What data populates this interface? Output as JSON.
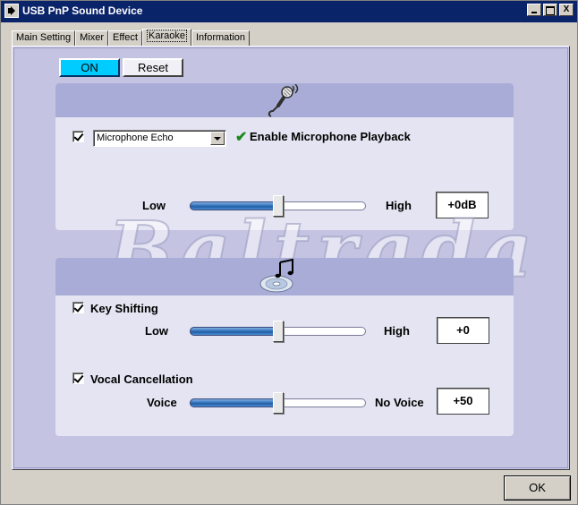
{
  "window": {
    "title": "USB PnP Sound Device",
    "buttons": {
      "minimize": "_",
      "maximize": "□",
      "close": "X"
    }
  },
  "tabs": [
    {
      "label": "Main Setting",
      "active": false
    },
    {
      "label": "Mixer",
      "active": false
    },
    {
      "label": "Effect",
      "active": false
    },
    {
      "label": "Karaoke",
      "active": true
    },
    {
      "label": "Information",
      "active": false
    }
  ],
  "karaoke": {
    "on_label": "ON",
    "reset_label": "Reset",
    "watermark": "Baltrada",
    "microphone": {
      "icon": "microphone-icon",
      "checked": true,
      "effect_select": "Microphone Echo",
      "playback_label": "Enable Microphone Playback",
      "low_label": "Low",
      "high_label": "High",
      "level_fraction": 0.5,
      "value": "+0dB"
    },
    "music": {
      "icon": "music-cd-icon",
      "key_shifting": {
        "checked": true,
        "label": "Key Shifting",
        "low_label": "Low",
        "high_label": "High",
        "level_fraction": 0.5,
        "value": "+0"
      },
      "vocal_cancellation": {
        "checked": true,
        "label": "Vocal Cancellation",
        "low_label": "Voice",
        "high_label": "No Voice",
        "level_fraction": 0.5,
        "value": "+50"
      }
    }
  },
  "footer": {
    "ok_label": "OK"
  },
  "colors": {
    "title_bar": "#0a246a",
    "on_button": "#00ccff",
    "section_band": "#a8acd6",
    "panel": "#c4c4e2",
    "accent_check": "#1a8a1a"
  }
}
